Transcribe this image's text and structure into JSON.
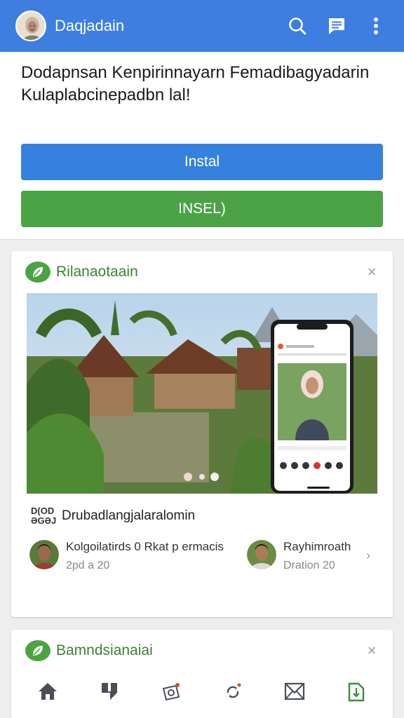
{
  "header": {
    "title": "Daqjadain",
    "icons": [
      "search-icon",
      "chat-icon",
      "more-vert-icon"
    ]
  },
  "install_panel": {
    "message": "Dodapnsan Kenpirinnayarn Femadibagyadarin Kulaplabcinepadbn lal!",
    "install_label": "Instal",
    "insel_label": "INSEL)",
    "colors": {
      "install": "#3681dd",
      "insel": "#4ba346"
    }
  },
  "card1": {
    "title": "Rilanaotaain",
    "close": "×",
    "caption_tag": "D(OD ƏGƏJ",
    "caption": "Drubadlangjalaralomin",
    "people": [
      {
        "name": "Kolgoilatirds 0 Rkat p ermacis",
        "sub": "2pd a 20"
      },
      {
        "name": "Rayhimroath",
        "sub": "Dration 20"
      }
    ],
    "carousel_dots": 3,
    "carousel_active": 1
  },
  "card2": {
    "title": "Bamndsianaiai",
    "close": "×",
    "icons": [
      "home-icon",
      "quote-icon",
      "camera-icon",
      "sync-icon",
      "inbox-icon",
      "bookmark-icon"
    ]
  },
  "colors": {
    "appbar": "#3d7ee0",
    "accent_green": "#4ca344"
  }
}
